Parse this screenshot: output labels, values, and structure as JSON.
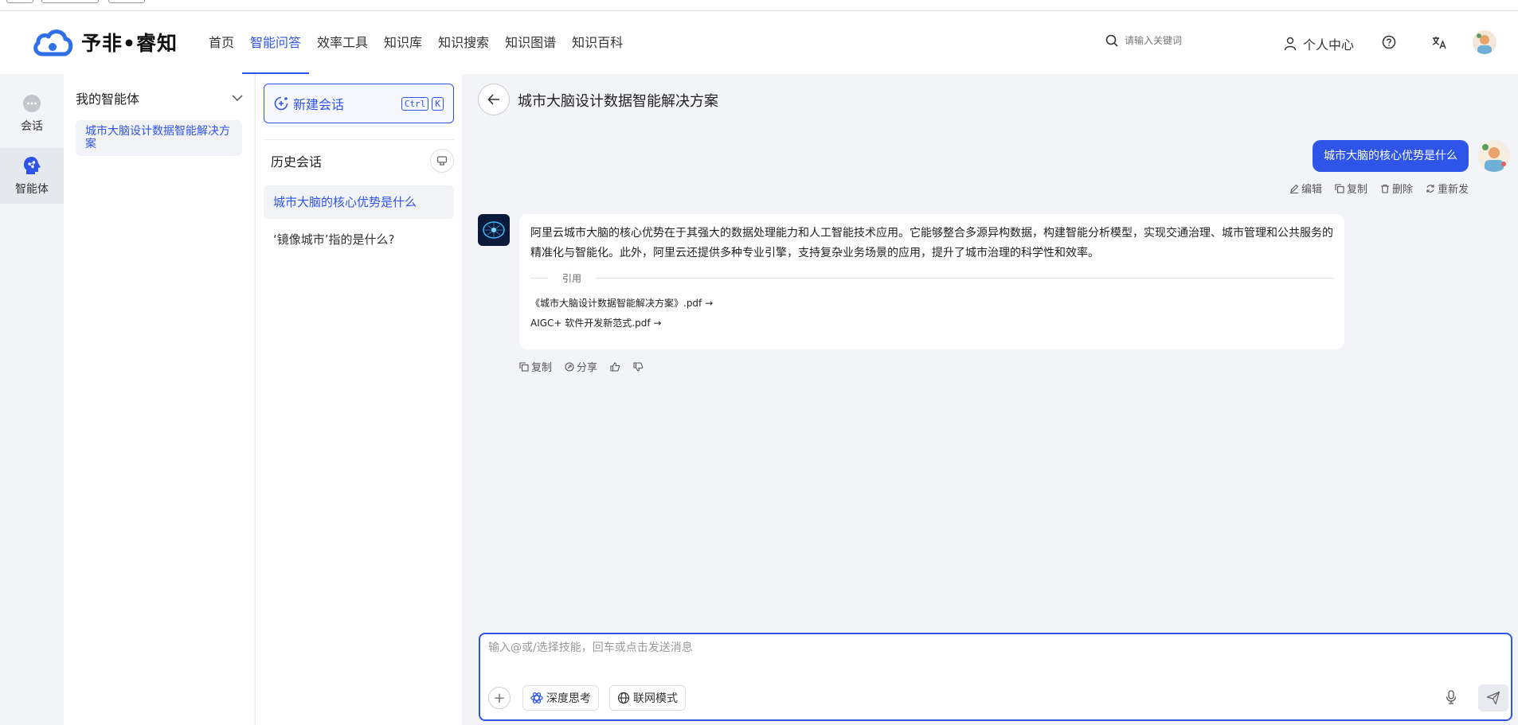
{
  "brand": {
    "name": "予非•睿知"
  },
  "nav": {
    "items": [
      "首页",
      "智能问答",
      "效率工具",
      "知识库",
      "知识搜索",
      "知识图谱",
      "知识百科"
    ],
    "active_index": 1
  },
  "search": {
    "placeholder": "请输入关键词"
  },
  "header": {
    "user_center": "个人中心"
  },
  "rail": {
    "chat_label": "会话",
    "agent_label": "智能体"
  },
  "agents": {
    "title": "我的智能体",
    "items": [
      "城市大脑设计数据智能解决方案"
    ]
  },
  "history": {
    "new_chat": "新建会话",
    "shortcut_ctrl": "Ctrl",
    "shortcut_key": "K",
    "title": "历史会话",
    "items": [
      "城市大脑的核心优势是什么",
      "‘镜像城市’指的是什么?"
    ]
  },
  "chat": {
    "title": "城市大脑设计数据智能解决方案",
    "user_message": "城市大脑的核心优势是什么",
    "user_actions": {
      "edit": "编辑",
      "copy": "复制",
      "delete": "删除",
      "resend": "重新发"
    },
    "bot_message": "阿里云城市大脑的核心优势在于其强大的数据处理能力和人工智能技术应用。它能够整合多源异构数据，构建智能分析模型，实现交通治理、城市管理和公共服务的精准化与智能化。此外，阿里云还提供多种专业引擎，支持复杂业务场景的应用，提升了城市治理的科学性和效率。",
    "citation_label": "引用",
    "citations": [
      "《城市大脑设计数据智能解决方案》.pdf →",
      "AIGC+ 软件开发新范式.pdf →"
    ],
    "bot_actions": {
      "copy": "复制",
      "share": "分享"
    }
  },
  "input": {
    "placeholder": "输入@或/选择技能，回车或点击发送消息",
    "deep_think": "深度思考",
    "web_mode": "联网模式"
  },
  "colors": {
    "accent": "#2f55e8",
    "background": "#f3f4f8",
    "logo": "#2f6fe8"
  }
}
